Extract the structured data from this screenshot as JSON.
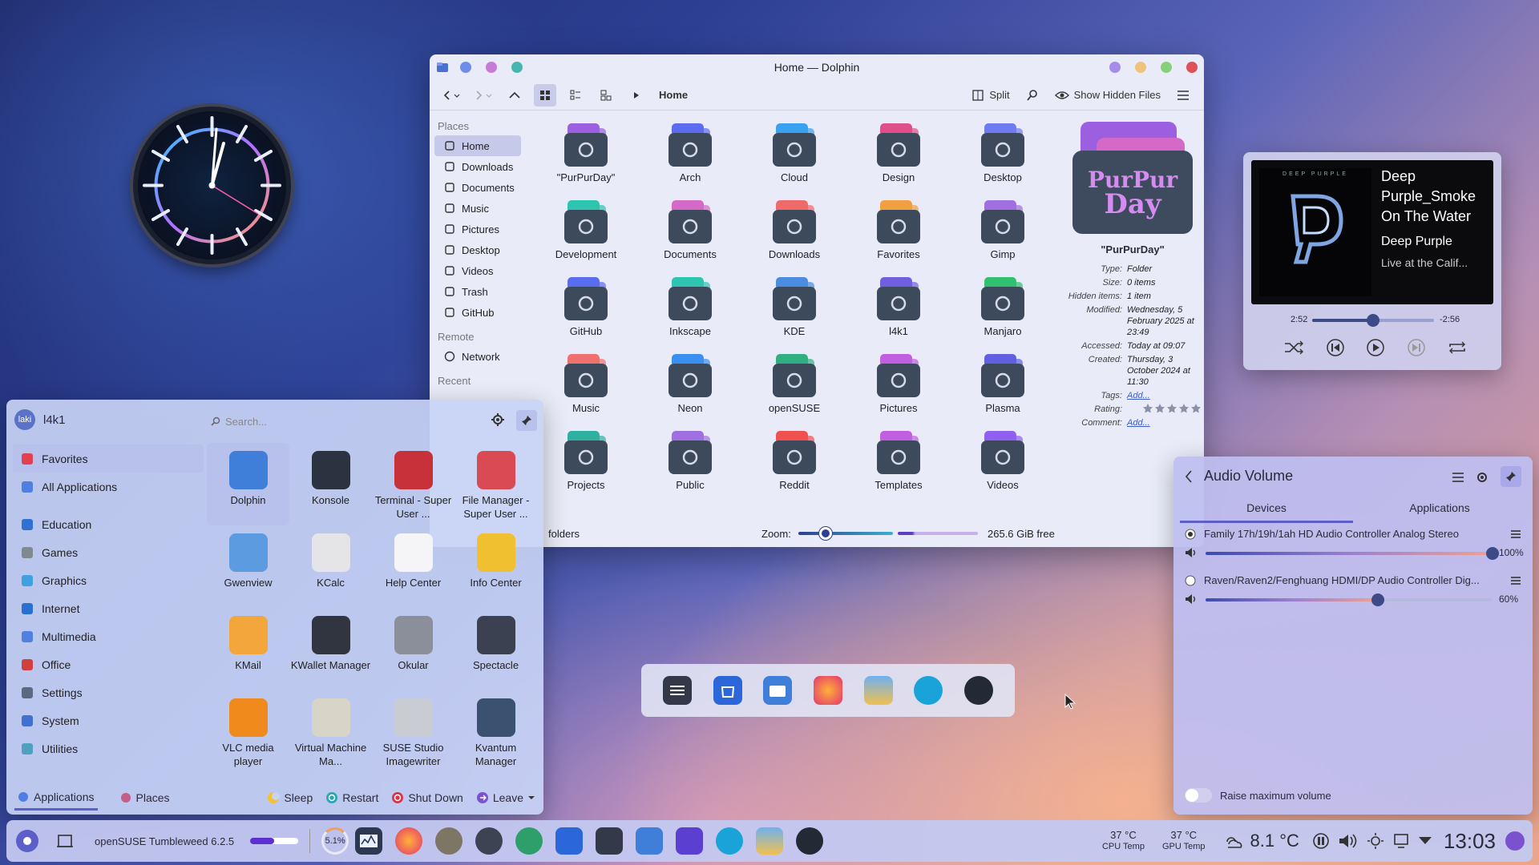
{
  "colors": {
    "accent": "#5b5fc7",
    "folder_top": "#9b5fe0",
    "folder_body": "#3a4658",
    "close": "#e0505b"
  },
  "dolphin": {
    "title": "Home — Dolphin",
    "breadcrumb": "Home",
    "split_label": "Split",
    "hidden_label": "Show Hidden Files",
    "places_header": "Places",
    "remote_header": "Remote",
    "recent_header": "Recent",
    "places": [
      {
        "label": "Home",
        "icon": "home-icon"
      },
      {
        "label": "Downloads",
        "icon": "download-icon"
      },
      {
        "label": "Documents",
        "icon": "document-icon"
      },
      {
        "label": "Music",
        "icon": "music-icon"
      },
      {
        "label": "Pictures",
        "icon": "picture-icon"
      },
      {
        "label": "Desktop",
        "icon": "desktop-icon"
      },
      {
        "label": "Videos",
        "icon": "video-icon"
      },
      {
        "label": "Trash",
        "icon": "trash-icon"
      },
      {
        "label": "GitHub",
        "icon": "github-icon"
      }
    ],
    "remote": [
      {
        "label": "Network",
        "icon": "network-icon"
      }
    ],
    "folders": [
      "\"PurPurDay\"",
      "Arch",
      "Cloud",
      "Design",
      "Desktop",
      "Development",
      "Documents",
      "Downloads",
      "Favorites",
      "Gimp",
      "GitHub",
      "Inkscape",
      "KDE",
      "l4k1",
      "Manjaro",
      "Music",
      "Neon",
      "openSUSE",
      "Pictures",
      "Plasma",
      "Projects",
      "Public",
      "Reddit",
      "Templates",
      "Videos"
    ],
    "info": {
      "preview_text_1": "PurPur",
      "preview_text_2": "Day",
      "name": "\"PurPurDay\"",
      "rows": [
        {
          "k": "Type:",
          "v": "Folder"
        },
        {
          "k": "Size:",
          "v": "0 items"
        },
        {
          "k": "Hidden items:",
          "v": "1 item"
        },
        {
          "k": "Modified:",
          "v": "Wednesday, 5 February 2025 at 23:49"
        },
        {
          "k": "Accessed:",
          "v": "Today at 09:07"
        },
        {
          "k": "Created:",
          "v": "Thursday, 3 October 2024 at 11:30"
        },
        {
          "k": "Tags:",
          "v": "Add..."
        },
        {
          "k": "Rating:",
          "v": ""
        },
        {
          "k": "Comment:",
          "v": "Add..."
        }
      ]
    },
    "status": {
      "left": "folders",
      "zoom_label": "Zoom:",
      "free": "265.6 GiB free"
    }
  },
  "launcher": {
    "user": "l4k1",
    "avatar_text": "laki",
    "search_placeholder": "Search...",
    "categories": [
      {
        "label": "Favorites",
        "icon": "heart-icon"
      },
      {
        "label": "All Applications",
        "icon": "grid-icon"
      },
      {
        "label": "Education",
        "icon": "education-icon"
      },
      {
        "label": "Games",
        "icon": "gamepad-icon"
      },
      {
        "label": "Graphics",
        "icon": "graphics-icon"
      },
      {
        "label": "Internet",
        "icon": "globe-icon"
      },
      {
        "label": "Multimedia",
        "icon": "multimedia-icon"
      },
      {
        "label": "Office",
        "icon": "office-icon"
      },
      {
        "label": "Settings",
        "icon": "settings-icon"
      },
      {
        "label": "System",
        "icon": "system-icon"
      },
      {
        "label": "Utilities",
        "icon": "utilities-icon"
      }
    ],
    "apps": [
      {
        "label": "Dolphin",
        "color": "#3f7fd9"
      },
      {
        "label": "Konsole",
        "color": "#2b3240"
      },
      {
        "label": "Terminal - Super User ...",
        "color": "#c8303a"
      },
      {
        "label": "File Manager - Super User ...",
        "color": "#d94a55"
      },
      {
        "label": "Gwenview",
        "color": "#5d9be0"
      },
      {
        "label": "KCalc",
        "color": "#e5e5e8"
      },
      {
        "label": "Help Center",
        "color": "#f5f5f7"
      },
      {
        "label": "Info Center",
        "color": "#f0c030"
      },
      {
        "label": "KMail",
        "color": "#f2a63b"
      },
      {
        "label": "KWallet Manager",
        "color": "#30353f"
      },
      {
        "label": "Okular",
        "color": "#8a8f9a"
      },
      {
        "label": "Spectacle",
        "color": "#3b4150"
      },
      {
        "label": "VLC media player",
        "color": "#f08a1c"
      },
      {
        "label": "Virtual Machine Ma...",
        "color": "#d8d4c8"
      },
      {
        "label": "SUSE Studio Imagewriter",
        "color": "#c9ccd2"
      },
      {
        "label": "Kvantum Manager",
        "color": "#3a5270"
      }
    ],
    "footer": {
      "applications": "Applications",
      "places": "Places",
      "sleep": "Sleep",
      "restart": "Restart",
      "shutdown": "Shut Down",
      "leave": "Leave"
    }
  },
  "media": {
    "album_text": "DEEP PURPLE",
    "title_line1": "Deep",
    "title_line2": "Purple_Smoke",
    "title_line3": "On The Water",
    "artist": "Deep Purple",
    "album": "Live at the Calif...",
    "elapsed": "2:52",
    "remaining": "-2:56",
    "progress": 0.5
  },
  "audio": {
    "title": "Audio Volume",
    "tab_devices": "Devices",
    "tab_applications": "Applications",
    "devices": [
      {
        "name": "Family 17h/19h/1ah HD Audio Controller Analog Stereo",
        "volume": "100%",
        "level": 1.0
      },
      {
        "name": "Raven/Raven2/Fenghuang HDMI/DP Audio Controller Dig...",
        "volume": "60%",
        "level": 0.6
      }
    ],
    "raise_label": "Raise maximum volume"
  },
  "taskbar": {
    "distro": "openSUSE Tumbleweed 6.2.5",
    "cpu_load": "5.1%",
    "cpu_temp": "37 °C",
    "cpu_temp_label": "CPU Temp",
    "gpu_temp": "37 °C",
    "gpu_temp_label": "GPU Temp",
    "weather": "8.1 °C",
    "time": "13:03"
  }
}
